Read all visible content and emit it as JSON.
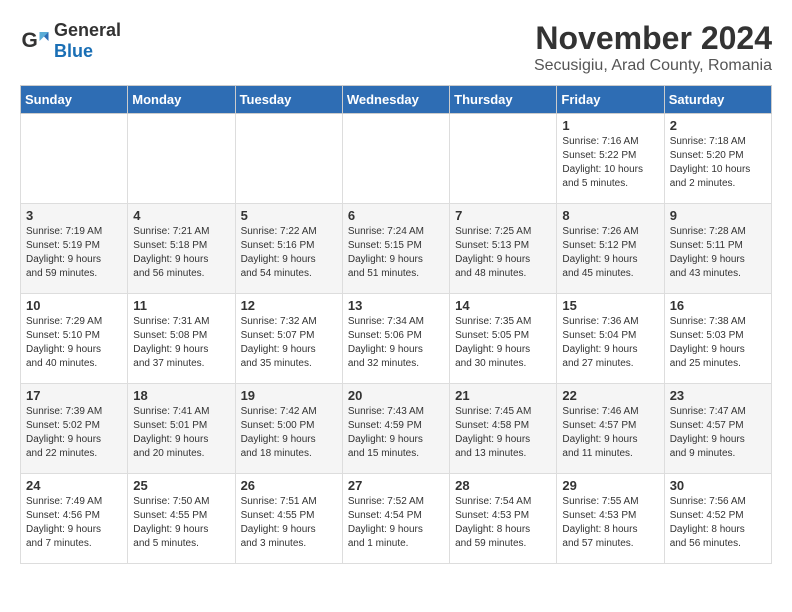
{
  "logo": {
    "general": "General",
    "blue": "Blue"
  },
  "title": "November 2024",
  "subtitle": "Secusigiu, Arad County, Romania",
  "headers": [
    "Sunday",
    "Monday",
    "Tuesday",
    "Wednesday",
    "Thursday",
    "Friday",
    "Saturday"
  ],
  "weeks": [
    [
      {
        "day": "",
        "info": ""
      },
      {
        "day": "",
        "info": ""
      },
      {
        "day": "",
        "info": ""
      },
      {
        "day": "",
        "info": ""
      },
      {
        "day": "",
        "info": ""
      },
      {
        "day": "1",
        "info": "Sunrise: 7:16 AM\nSunset: 5:22 PM\nDaylight: 10 hours\nand 5 minutes."
      },
      {
        "day": "2",
        "info": "Sunrise: 7:18 AM\nSunset: 5:20 PM\nDaylight: 10 hours\nand 2 minutes."
      }
    ],
    [
      {
        "day": "3",
        "info": "Sunrise: 7:19 AM\nSunset: 5:19 PM\nDaylight: 9 hours\nand 59 minutes."
      },
      {
        "day": "4",
        "info": "Sunrise: 7:21 AM\nSunset: 5:18 PM\nDaylight: 9 hours\nand 56 minutes."
      },
      {
        "day": "5",
        "info": "Sunrise: 7:22 AM\nSunset: 5:16 PM\nDaylight: 9 hours\nand 54 minutes."
      },
      {
        "day": "6",
        "info": "Sunrise: 7:24 AM\nSunset: 5:15 PM\nDaylight: 9 hours\nand 51 minutes."
      },
      {
        "day": "7",
        "info": "Sunrise: 7:25 AM\nSunset: 5:13 PM\nDaylight: 9 hours\nand 48 minutes."
      },
      {
        "day": "8",
        "info": "Sunrise: 7:26 AM\nSunset: 5:12 PM\nDaylight: 9 hours\nand 45 minutes."
      },
      {
        "day": "9",
        "info": "Sunrise: 7:28 AM\nSunset: 5:11 PM\nDaylight: 9 hours\nand 43 minutes."
      }
    ],
    [
      {
        "day": "10",
        "info": "Sunrise: 7:29 AM\nSunset: 5:10 PM\nDaylight: 9 hours\nand 40 minutes."
      },
      {
        "day": "11",
        "info": "Sunrise: 7:31 AM\nSunset: 5:08 PM\nDaylight: 9 hours\nand 37 minutes."
      },
      {
        "day": "12",
        "info": "Sunrise: 7:32 AM\nSunset: 5:07 PM\nDaylight: 9 hours\nand 35 minutes."
      },
      {
        "day": "13",
        "info": "Sunrise: 7:34 AM\nSunset: 5:06 PM\nDaylight: 9 hours\nand 32 minutes."
      },
      {
        "day": "14",
        "info": "Sunrise: 7:35 AM\nSunset: 5:05 PM\nDaylight: 9 hours\nand 30 minutes."
      },
      {
        "day": "15",
        "info": "Sunrise: 7:36 AM\nSunset: 5:04 PM\nDaylight: 9 hours\nand 27 minutes."
      },
      {
        "day": "16",
        "info": "Sunrise: 7:38 AM\nSunset: 5:03 PM\nDaylight: 9 hours\nand 25 minutes."
      }
    ],
    [
      {
        "day": "17",
        "info": "Sunrise: 7:39 AM\nSunset: 5:02 PM\nDaylight: 9 hours\nand 22 minutes."
      },
      {
        "day": "18",
        "info": "Sunrise: 7:41 AM\nSunset: 5:01 PM\nDaylight: 9 hours\nand 20 minutes."
      },
      {
        "day": "19",
        "info": "Sunrise: 7:42 AM\nSunset: 5:00 PM\nDaylight: 9 hours\nand 18 minutes."
      },
      {
        "day": "20",
        "info": "Sunrise: 7:43 AM\nSunset: 4:59 PM\nDaylight: 9 hours\nand 15 minutes."
      },
      {
        "day": "21",
        "info": "Sunrise: 7:45 AM\nSunset: 4:58 PM\nDaylight: 9 hours\nand 13 minutes."
      },
      {
        "day": "22",
        "info": "Sunrise: 7:46 AM\nSunset: 4:57 PM\nDaylight: 9 hours\nand 11 minutes."
      },
      {
        "day": "23",
        "info": "Sunrise: 7:47 AM\nSunset: 4:57 PM\nDaylight: 9 hours\nand 9 minutes."
      }
    ],
    [
      {
        "day": "24",
        "info": "Sunrise: 7:49 AM\nSunset: 4:56 PM\nDaylight: 9 hours\nand 7 minutes."
      },
      {
        "day": "25",
        "info": "Sunrise: 7:50 AM\nSunset: 4:55 PM\nDaylight: 9 hours\nand 5 minutes."
      },
      {
        "day": "26",
        "info": "Sunrise: 7:51 AM\nSunset: 4:55 PM\nDaylight: 9 hours\nand 3 minutes."
      },
      {
        "day": "27",
        "info": "Sunrise: 7:52 AM\nSunset: 4:54 PM\nDaylight: 9 hours\nand 1 minute."
      },
      {
        "day": "28",
        "info": "Sunrise: 7:54 AM\nSunset: 4:53 PM\nDaylight: 8 hours\nand 59 minutes."
      },
      {
        "day": "29",
        "info": "Sunrise: 7:55 AM\nSunset: 4:53 PM\nDaylight: 8 hours\nand 57 minutes."
      },
      {
        "day": "30",
        "info": "Sunrise: 7:56 AM\nSunset: 4:52 PM\nDaylight: 8 hours\nand 56 minutes."
      }
    ]
  ]
}
